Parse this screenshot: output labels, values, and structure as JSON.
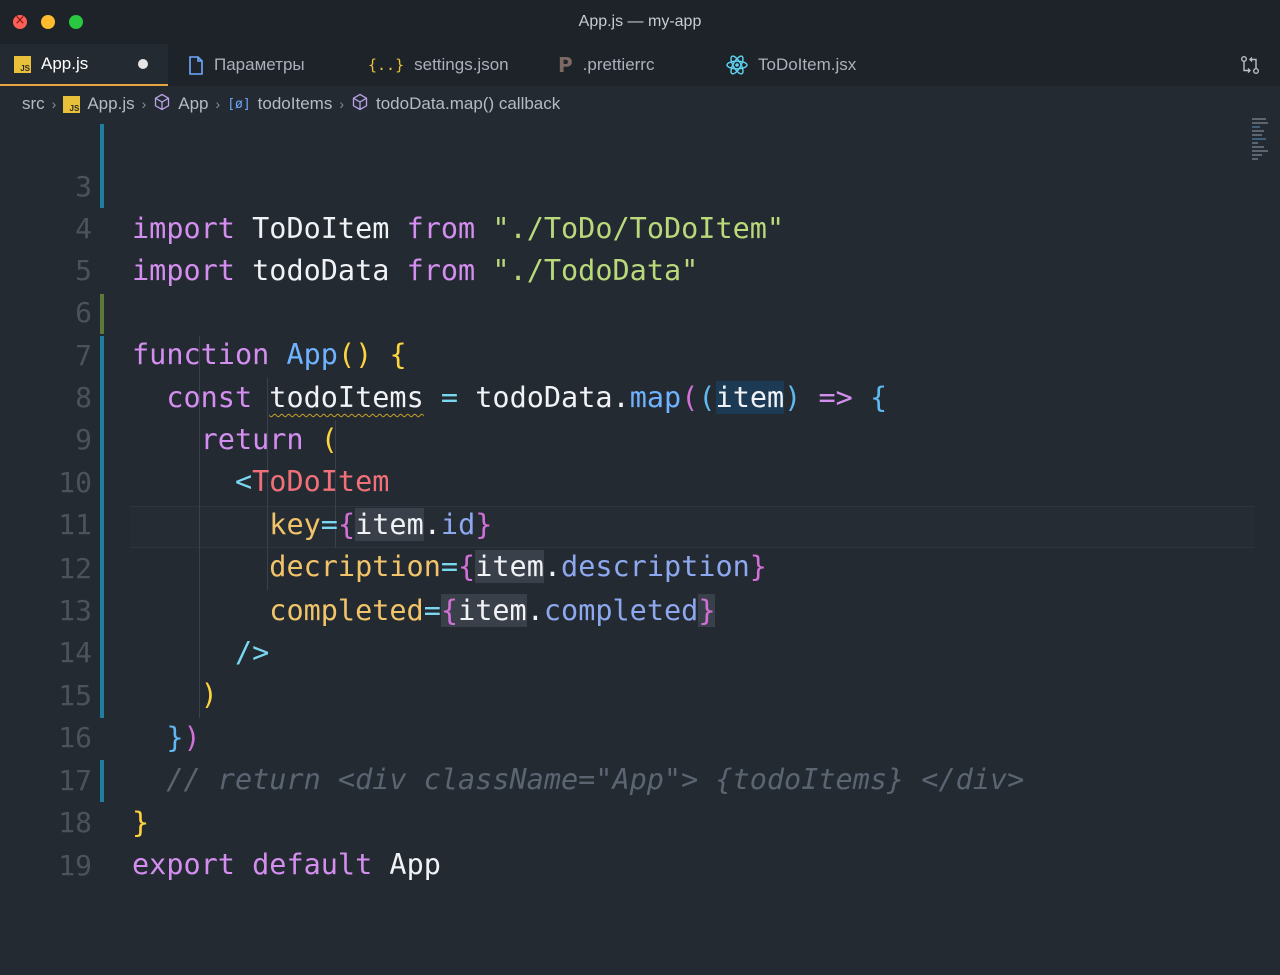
{
  "window": {
    "title": "App.js — my-app"
  },
  "tabs": [
    {
      "label": "App.js",
      "icon": "js-file-icon",
      "active": true,
      "modified": true
    },
    {
      "label": "Параметры",
      "icon": "file-icon",
      "active": false
    },
    {
      "label": "settings.json",
      "icon": "json-braces-icon",
      "active": false
    },
    {
      "label": ".prettierrc",
      "icon": "prettier-icon",
      "active": false
    },
    {
      "label": "ToDoItem.jsx",
      "icon": "react-icon",
      "active": false
    }
  ],
  "tab_icons_text": {
    "js": "JS",
    "braces": "{..}",
    "p": "P"
  },
  "breadcrumb": {
    "items": [
      "src",
      "App.js",
      "App",
      "todoItems",
      "todoData.map() callback"
    ],
    "var_icon": "[ø]"
  },
  "editor": {
    "line_numbers": [
      "3",
      "4",
      "5",
      "6",
      "7",
      "8",
      "9",
      "10",
      "11",
      "12",
      "13",
      "14",
      "15",
      "16",
      "17",
      "18",
      "19"
    ],
    "tokens": {
      "import": "import",
      "from": "from",
      "ToDoItem": "ToDoItem",
      "todoData": "todoData",
      "path_todoitem": "\"./ToDo/ToDoItem\"",
      "path_tododata": "\"./TodoData\"",
      "function": "function",
      "App": "App",
      "parens": "()",
      "brace_open": "{",
      "brace_close": "}",
      "const": "const",
      "todoItems": "todoItems",
      "eq": "=",
      "dot": ".",
      "map": "map",
      "paren_open": "(",
      "paren_close": ")",
      "item": "item",
      "arrow": "=>",
      "return": "return",
      "tag_open": "<",
      "key": "key",
      "id": "id",
      "decription": "decription",
      "description": "description",
      "completed": "completed",
      "self_close": "/>",
      "close_brace_paren": "}",
      "comment": "// return <div className=\"App\"> {todoItems} </div>",
      "export": "export",
      "default": "default"
    }
  },
  "colors": {
    "background": "#242a31",
    "accent_tab": "#e8a33d",
    "keyword": "#d38ef0",
    "string": "#b9d97a",
    "function": "#6fb2ff",
    "tag": "#f0707a",
    "attribute": "#f2c46a",
    "comment": "#5b6571"
  }
}
